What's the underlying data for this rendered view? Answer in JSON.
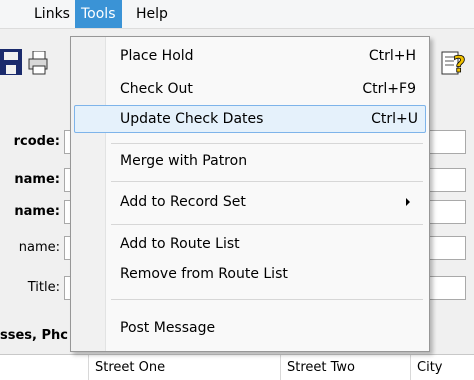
{
  "menubar": {
    "items": [
      {
        "label": "Links"
      },
      {
        "label": "Tools"
      },
      {
        "label": "Help"
      }
    ]
  },
  "toolbar": {
    "icons": [
      "save-icon",
      "print-icon",
      "help-icon"
    ]
  },
  "form": {
    "labels": [
      {
        "text": "rcode:",
        "bold": true
      },
      {
        "text": "name:",
        "bold": true
      },
      {
        "text": "name:",
        "bold": true
      },
      {
        "text": "name:",
        "bold": false
      },
      {
        "text": "Title:",
        "bold": false
      }
    ],
    "section": "sses, Phc"
  },
  "grid": {
    "columns": [
      "Street One",
      "Street Two",
      "City"
    ]
  },
  "tools_menu": {
    "items": [
      {
        "label": "Place Hold",
        "shortcut": "Ctrl+H"
      },
      {
        "label": "Check Out",
        "shortcut": "Ctrl+F9"
      },
      {
        "label": "Update Check Dates",
        "shortcut": "Ctrl+U"
      },
      {
        "label": "Merge with Patron",
        "shortcut": ""
      },
      {
        "label": "Add to Record Set",
        "shortcut": ""
      },
      {
        "label": "Add to Route List",
        "shortcut": ""
      },
      {
        "label": "Remove from Route List",
        "shortcut": ""
      },
      {
        "label": "Post Message",
        "shortcut": ""
      }
    ]
  },
  "colors": {
    "menu_active": "#3a93d6",
    "highlight_bg": "#e5f1fb",
    "highlight_border": "#7eb4ea"
  }
}
